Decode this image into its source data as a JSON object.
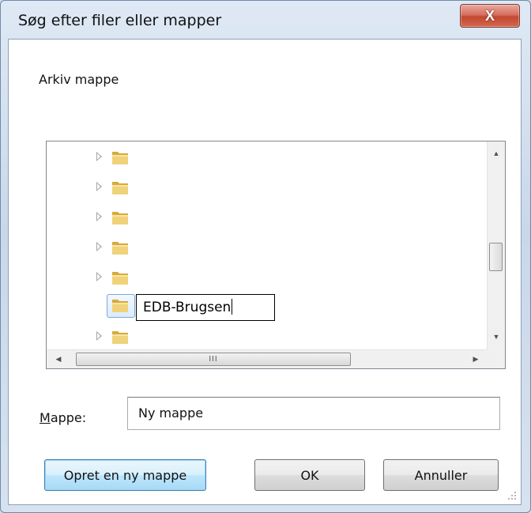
{
  "window": {
    "title": "Søg efter filer eller mapper",
    "close_glyph": "X"
  },
  "dialog": {
    "description": "Arkiv mappe"
  },
  "tree": {
    "items": [
      {
        "label": "",
        "expandable": true
      },
      {
        "label": "",
        "expandable": true
      },
      {
        "label": "",
        "expandable": true
      },
      {
        "label": "",
        "expandable": true
      },
      {
        "label": "",
        "expandable": true
      },
      {
        "label": "EDB-Brugsen",
        "expandable": false,
        "selected": true,
        "editing": true
      },
      {
        "label": "",
        "expandable": true
      }
    ],
    "rename_value": "EDB-Brugsen",
    "hscroll_thumb_glyph": "III"
  },
  "folder": {
    "label": "Mappe:",
    "label_accesskey": "M",
    "label_rest": "appe:",
    "value": "Ny mappe"
  },
  "buttons": {
    "new_folder": "Opret en ny mappe",
    "ok": "OK",
    "cancel": "Annuller"
  },
  "icons": {
    "folder": "folder-icon",
    "expander": "chevron-right-icon",
    "close": "close-icon"
  },
  "colors": {
    "accent": "#3c7fb1",
    "close": "#c24731",
    "folder": "#e7c24e"
  }
}
